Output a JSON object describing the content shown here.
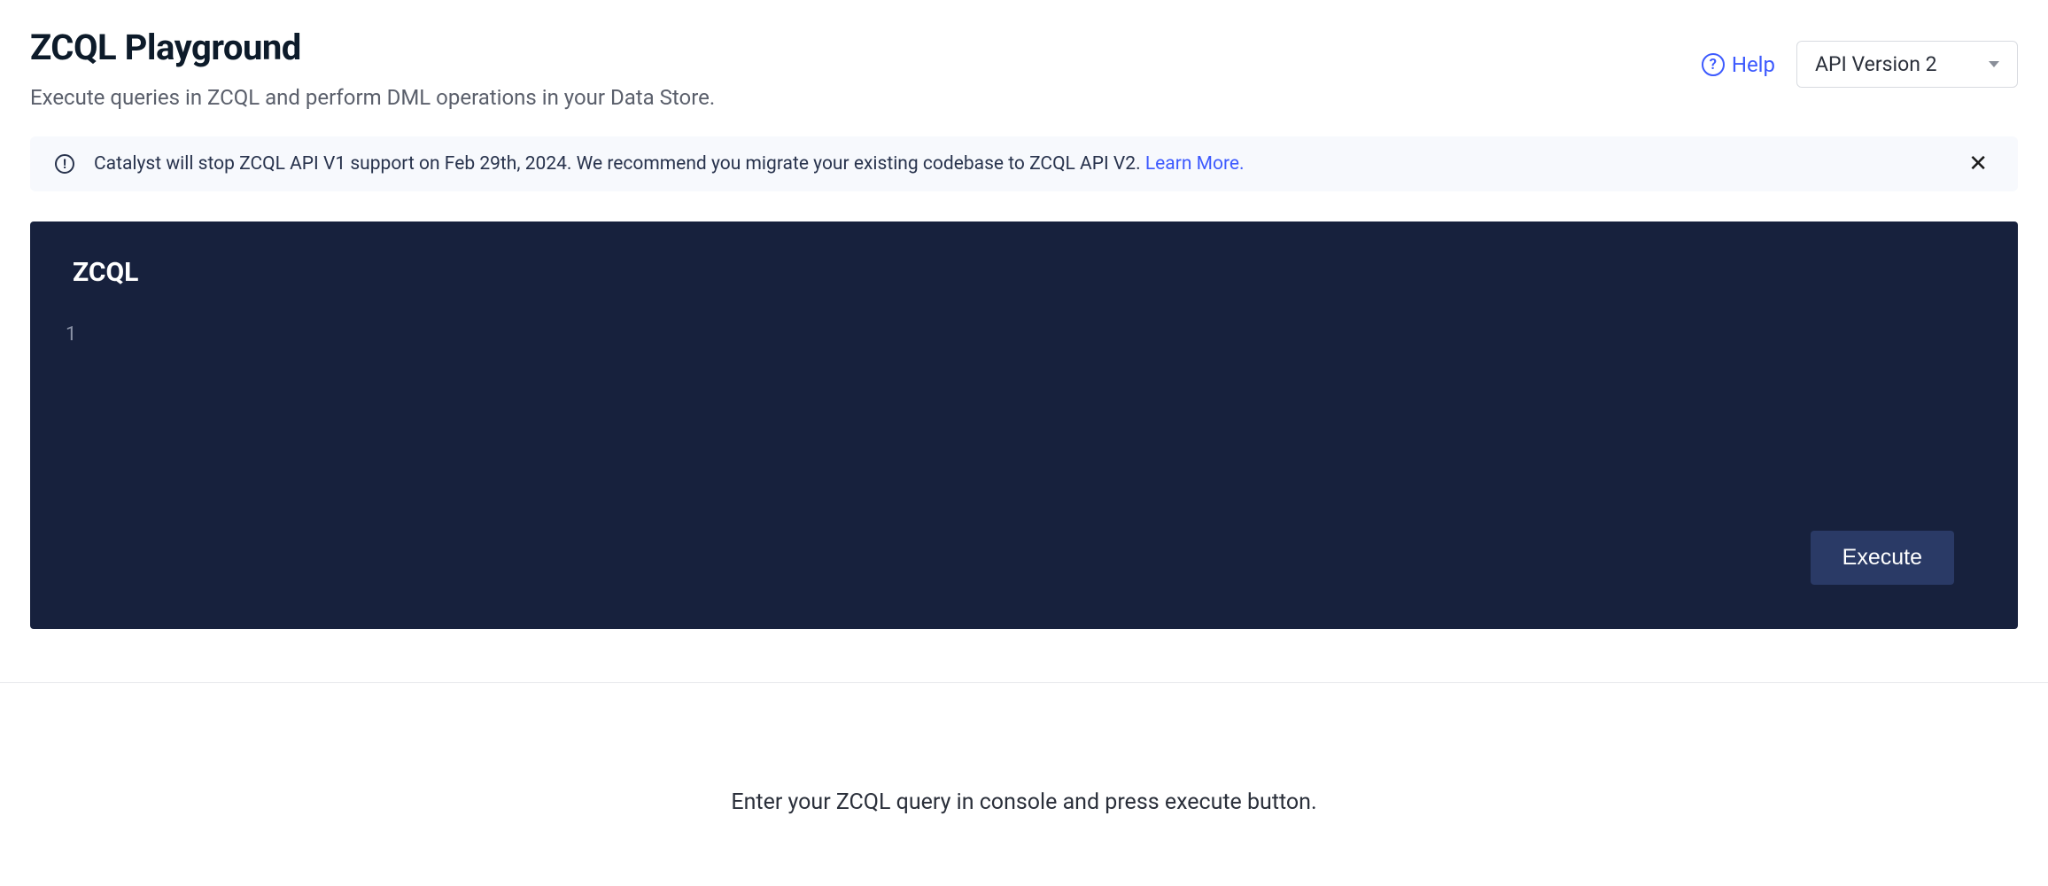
{
  "header": {
    "title": "ZCQL Playground",
    "subtitle": "Execute queries in ZCQL and perform DML operations in your Data Store.",
    "help_label": "Help",
    "version_selected": "API Version 2"
  },
  "notice": {
    "message": "Catalyst will stop ZCQL API V1 support on Feb 29th, 2024. We recommend you migrate your existing codebase to ZCQL API V2. ",
    "link_text": "Learn More."
  },
  "editor": {
    "label": "ZCQL",
    "line_number": "1",
    "code": "",
    "execute_label": "Execute"
  },
  "hint": "Enter your ZCQL query in console and press execute button."
}
